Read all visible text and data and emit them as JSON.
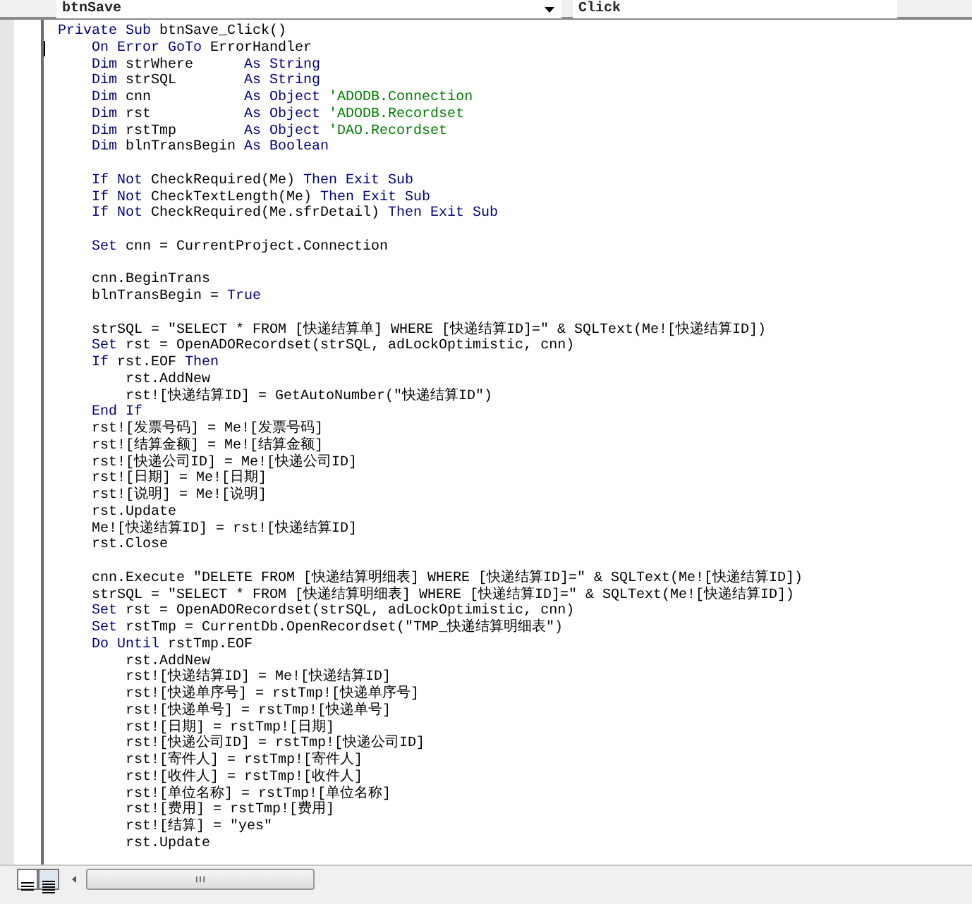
{
  "toolbar": {
    "object_dropdown": {
      "value": "btnSave"
    },
    "procedure_dropdown": {
      "value": "Click"
    }
  },
  "code_lines": [
    {
      "kind": "code",
      "parts": [
        {
          "kind": "keyword",
          "text": "Private Sub"
        },
        {
          "kind": "plain",
          "text": " btnSave_Click()"
        }
      ]
    },
    {
      "kind": "code",
      "cursor": true,
      "parts": [
        {
          "kind": "keyword",
          "text": "    On Error GoTo"
        },
        {
          "kind": "plain",
          "text": " ErrorHandler"
        }
      ]
    },
    {
      "kind": "code",
      "parts": [
        {
          "kind": "keyword",
          "text": "    Dim"
        },
        {
          "kind": "plain",
          "text": " strWhere      "
        },
        {
          "kind": "keyword",
          "text": "As String"
        }
      ]
    },
    {
      "kind": "code",
      "parts": [
        {
          "kind": "keyword",
          "text": "    Dim"
        },
        {
          "kind": "plain",
          "text": " strSQL        "
        },
        {
          "kind": "keyword",
          "text": "As String"
        }
      ]
    },
    {
      "kind": "code",
      "parts": [
        {
          "kind": "keyword",
          "text": "    Dim"
        },
        {
          "kind": "plain",
          "text": " cnn           "
        },
        {
          "kind": "keyword",
          "text": "As Object"
        },
        {
          "kind": "comment",
          "text": " 'ADODB.Connection"
        }
      ]
    },
    {
      "kind": "code",
      "parts": [
        {
          "kind": "keyword",
          "text": "    Dim"
        },
        {
          "kind": "plain",
          "text": " rst           "
        },
        {
          "kind": "keyword",
          "text": "As Object"
        },
        {
          "kind": "comment",
          "text": " 'ADODB.Recordset"
        }
      ]
    },
    {
      "kind": "code",
      "parts": [
        {
          "kind": "keyword",
          "text": "    Dim"
        },
        {
          "kind": "plain",
          "text": " rstTmp        "
        },
        {
          "kind": "keyword",
          "text": "As Object"
        },
        {
          "kind": "comment",
          "text": " 'DAO.Recordset"
        }
      ]
    },
    {
      "kind": "code",
      "parts": [
        {
          "kind": "keyword",
          "text": "    Dim"
        },
        {
          "kind": "plain",
          "text": " blnTransBegin "
        },
        {
          "kind": "keyword",
          "text": "As Boolean"
        }
      ]
    },
    {
      "kind": "blank"
    },
    {
      "kind": "code",
      "parts": [
        {
          "kind": "keyword",
          "text": "    If Not"
        },
        {
          "kind": "plain",
          "text": " CheckRequired(Me) "
        },
        {
          "kind": "keyword",
          "text": "Then Exit Sub"
        }
      ]
    },
    {
      "kind": "code",
      "parts": [
        {
          "kind": "keyword",
          "text": "    If Not"
        },
        {
          "kind": "plain",
          "text": " CheckTextLength(Me) "
        },
        {
          "kind": "keyword",
          "text": "Then Exit Sub"
        }
      ]
    },
    {
      "kind": "code",
      "parts": [
        {
          "kind": "keyword",
          "text": "    If Not"
        },
        {
          "kind": "plain",
          "text": " CheckRequired(Me.sfrDetail) "
        },
        {
          "kind": "keyword",
          "text": "Then Exit Sub"
        }
      ]
    },
    {
      "kind": "blank"
    },
    {
      "kind": "code",
      "parts": [
        {
          "kind": "keyword",
          "text": "    Set"
        },
        {
          "kind": "plain",
          "text": " cnn = CurrentProject.Connection"
        }
      ]
    },
    {
      "kind": "blank"
    },
    {
      "kind": "code",
      "parts": [
        {
          "kind": "plain",
          "text": "    cnn.BeginTrans"
        }
      ]
    },
    {
      "kind": "code",
      "parts": [
        {
          "kind": "plain",
          "text": "    blnTransBegin = "
        },
        {
          "kind": "keyword",
          "text": "True"
        }
      ]
    },
    {
      "kind": "blank"
    },
    {
      "kind": "code",
      "parts": [
        {
          "kind": "plain",
          "text": "    strSQL = \"SELECT * FROM [快递结算单] WHERE [快递结算ID]=\" & SQLText(Me![快递结算ID])"
        }
      ]
    },
    {
      "kind": "code",
      "parts": [
        {
          "kind": "keyword",
          "text": "    Set"
        },
        {
          "kind": "plain",
          "text": " rst = OpenADORecordset(strSQL, adLockOptimistic, cnn)"
        }
      ]
    },
    {
      "kind": "code",
      "parts": [
        {
          "kind": "keyword",
          "text": "    If"
        },
        {
          "kind": "plain",
          "text": " rst.EOF "
        },
        {
          "kind": "keyword",
          "text": "Then"
        }
      ]
    },
    {
      "kind": "code",
      "parts": [
        {
          "kind": "plain",
          "text": "        rst.AddNew"
        }
      ]
    },
    {
      "kind": "code",
      "parts": [
        {
          "kind": "plain",
          "text": "        rst![快递结算ID] = GetAutoNumber(\"快递结算ID\")"
        }
      ]
    },
    {
      "kind": "code",
      "parts": [
        {
          "kind": "keyword",
          "text": "    End If"
        }
      ]
    },
    {
      "kind": "code",
      "parts": [
        {
          "kind": "plain",
          "text": "    rst![发票号码] = Me![发票号码]"
        }
      ]
    },
    {
      "kind": "code",
      "parts": [
        {
          "kind": "plain",
          "text": "    rst![结算金额] = Me![结算金额]"
        }
      ]
    },
    {
      "kind": "code",
      "parts": [
        {
          "kind": "plain",
          "text": "    rst![快递公司ID] = Me![快递公司ID]"
        }
      ]
    },
    {
      "kind": "code",
      "parts": [
        {
          "kind": "plain",
          "text": "    rst![日期] = Me![日期]"
        }
      ]
    },
    {
      "kind": "code",
      "parts": [
        {
          "kind": "plain",
          "text": "    rst![说明] = Me![说明]"
        }
      ]
    },
    {
      "kind": "code",
      "parts": [
        {
          "kind": "plain",
          "text": "    rst.Update"
        }
      ]
    },
    {
      "kind": "code",
      "parts": [
        {
          "kind": "plain",
          "text": "    Me![快递结算ID] = rst![快递结算ID]"
        }
      ]
    },
    {
      "kind": "code",
      "parts": [
        {
          "kind": "plain",
          "text": "    rst.Close"
        }
      ]
    },
    {
      "kind": "blank"
    },
    {
      "kind": "code",
      "parts": [
        {
          "kind": "plain",
          "text": "    cnn.Execute \"DELETE FROM [快递结算明细表] WHERE [快递结算ID]=\" & SQLText(Me![快递结算ID])"
        }
      ]
    },
    {
      "kind": "code",
      "parts": [
        {
          "kind": "plain",
          "text": "    strSQL = \"SELECT * FROM [快递结算明细表] WHERE [快递结算ID]=\" & SQLText(Me![快递结算ID])"
        }
      ]
    },
    {
      "kind": "code",
      "parts": [
        {
          "kind": "keyword",
          "text": "    Set"
        },
        {
          "kind": "plain",
          "text": " rst = OpenADORecordset(strSQL, adLockOptimistic, cnn)"
        }
      ]
    },
    {
      "kind": "code",
      "parts": [
        {
          "kind": "keyword",
          "text": "    Set"
        },
        {
          "kind": "plain",
          "text": " rstTmp = CurrentDb.OpenRecordset(\"TMP_快递结算明细表\")"
        }
      ]
    },
    {
      "kind": "code",
      "parts": [
        {
          "kind": "keyword",
          "text": "    Do Until"
        },
        {
          "kind": "plain",
          "text": " rstTmp.EOF"
        }
      ]
    },
    {
      "kind": "code",
      "parts": [
        {
          "kind": "plain",
          "text": "        rst.AddNew"
        }
      ]
    },
    {
      "kind": "code",
      "parts": [
        {
          "kind": "plain",
          "text": "        rst![快递结算ID] = Me![快递结算ID]"
        }
      ]
    },
    {
      "kind": "code",
      "parts": [
        {
          "kind": "plain",
          "text": "        rst![快递单序号] = rstTmp![快递单序号]"
        }
      ]
    },
    {
      "kind": "code",
      "parts": [
        {
          "kind": "plain",
          "text": "        rst![快递单号] = rstTmp![快递单号]"
        }
      ]
    },
    {
      "kind": "code",
      "parts": [
        {
          "kind": "plain",
          "text": "        rst![日期] = rstTmp![日期]"
        }
      ]
    },
    {
      "kind": "code",
      "parts": [
        {
          "kind": "plain",
          "text": "        rst![快递公司ID] = rstTmp![快递公司ID]"
        }
      ]
    },
    {
      "kind": "code",
      "parts": [
        {
          "kind": "plain",
          "text": "        rst![寄件人] = rstTmp![寄件人]"
        }
      ]
    },
    {
      "kind": "code",
      "parts": [
        {
          "kind": "plain",
          "text": "        rst![收件人] = rstTmp![收件人]"
        }
      ]
    },
    {
      "kind": "code",
      "parts": [
        {
          "kind": "plain",
          "text": "        rst![单位名称] = rstTmp![单位名称]"
        }
      ]
    },
    {
      "kind": "code",
      "parts": [
        {
          "kind": "plain",
          "text": "        rst![费用] = rstTmp![费用]"
        }
      ]
    },
    {
      "kind": "code",
      "parts": [
        {
          "kind": "plain",
          "text": "        rst![结算] = \"yes\""
        }
      ]
    },
    {
      "kind": "code",
      "parts": [
        {
          "kind": "plain",
          "text": "        rst.Update"
        }
      ]
    }
  ]
}
